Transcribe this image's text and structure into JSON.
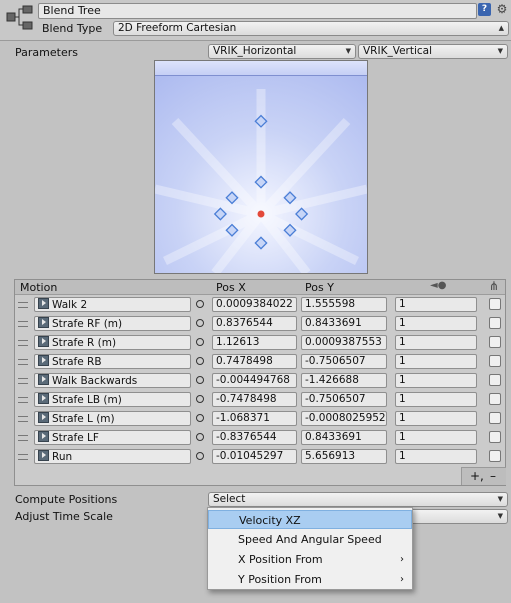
{
  "header": {
    "name_value": "Blend Tree",
    "blend_type_label": "Blend Type",
    "blend_type_value": "2D Freeform Cartesian",
    "help_icon": "help-icon",
    "settings_icon": "gear-icon"
  },
  "parameters": {
    "label": "Parameters",
    "x_param": "VRIK_Horizontal",
    "y_param": "VRIK_Vertical"
  },
  "visualization": {
    "points": [
      {
        "x": 0,
        "y": 1.6
      },
      {
        "x": 0,
        "y": 0.55
      },
      {
        "x": 0.5,
        "y": 0.28
      },
      {
        "x": -0.5,
        "y": 0.28
      },
      {
        "x": 0.7,
        "y": 0
      },
      {
        "x": -0.7,
        "y": 0
      },
      {
        "x": 0.5,
        "y": -0.28
      },
      {
        "x": -0.5,
        "y": -0.28
      },
      {
        "x": 0,
        "y": -0.5
      }
    ],
    "accent_color": "#e3493a",
    "point_color": "#4a7ed6"
  },
  "motion_table": {
    "headers": {
      "motion": "Motion",
      "pos_x": "Pos X",
      "pos_y": "Pos Y"
    },
    "rows": [
      {
        "name": "Walk 2",
        "pos_x": "0.0009384022",
        "pos_y": "1.555598",
        "speed": "1"
      },
      {
        "name": "Strafe RF (m)",
        "pos_x": "0.8376544",
        "pos_y": "0.8433691",
        "speed": "1"
      },
      {
        "name": "Strafe R (m)",
        "pos_x": "1.12613",
        "pos_y": "0.0009387553",
        "speed": "1"
      },
      {
        "name": "Strafe RB",
        "pos_x": "0.7478498",
        "pos_y": "-0.7506507",
        "speed": "1"
      },
      {
        "name": "Walk Backwards",
        "pos_x": "-0.004494768",
        "pos_y": "-1.426688",
        "speed": "1"
      },
      {
        "name": "Strafe LB (m)",
        "pos_x": "-0.7478498",
        "pos_y": "-0.7506507",
        "speed": "1"
      },
      {
        "name": "Strafe L (m)",
        "pos_x": "-1.068371",
        "pos_y": "-0.0008025952",
        "speed": "1"
      },
      {
        "name": "Strafe LF",
        "pos_x": "-0.8376544",
        "pos_y": "0.8433691",
        "speed": "1"
      },
      {
        "name": "Run",
        "pos_x": "-0.01045297",
        "pos_y": "5.656913",
        "speed": "1"
      }
    ],
    "add_symbol": "+,",
    "remove_symbol": "–"
  },
  "compute": {
    "label": "Compute Positions",
    "value": "Select"
  },
  "adjust": {
    "label": "Adjust Time Scale"
  },
  "menu": {
    "items": [
      {
        "label": "Velocity XZ",
        "submenu": ""
      },
      {
        "label": "Speed And Angular Speed",
        "submenu": ""
      },
      {
        "label": "X Position From",
        "submenu": "›"
      },
      {
        "label": "Y Position From",
        "submenu": "›"
      }
    ]
  }
}
